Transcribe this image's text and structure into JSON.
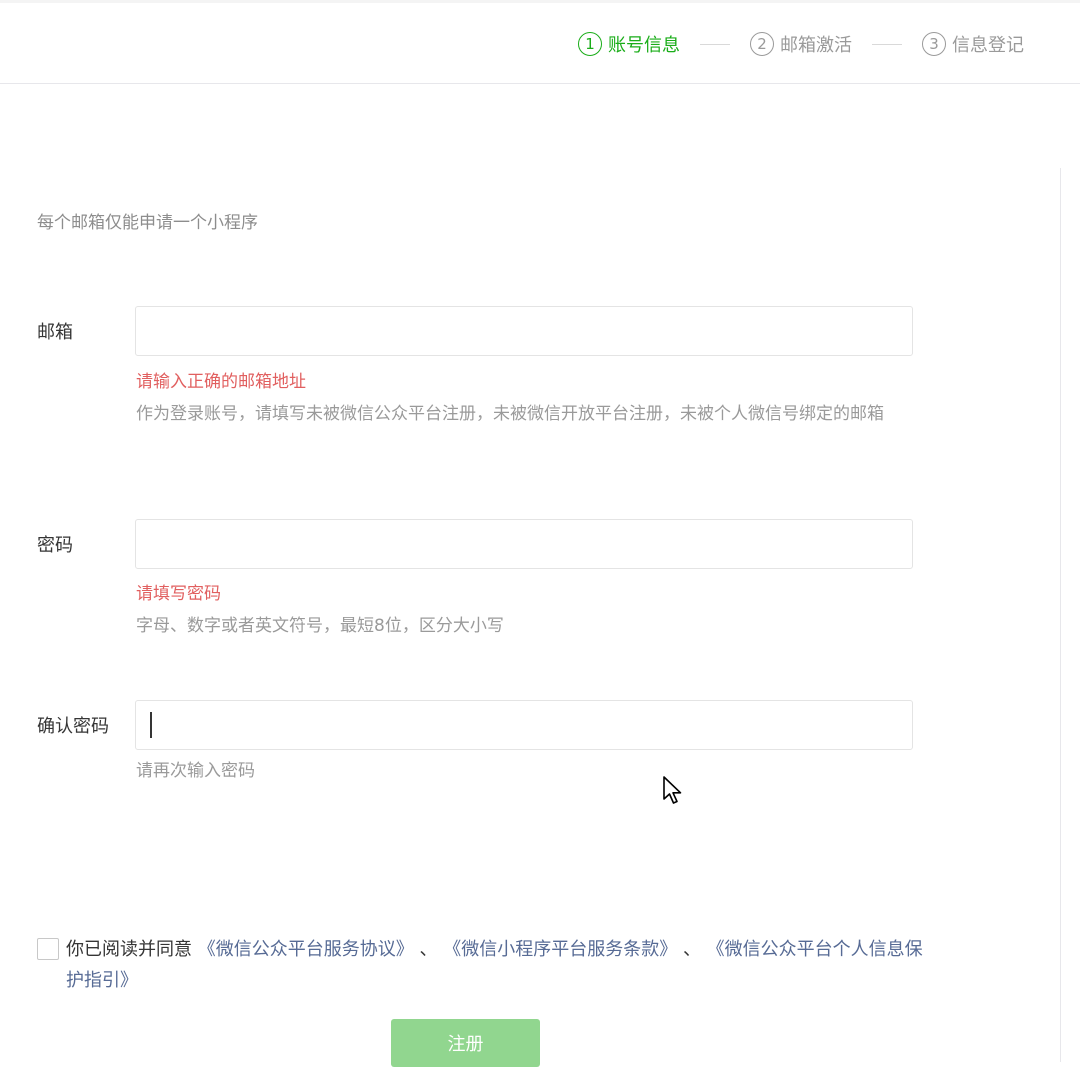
{
  "steps": [
    {
      "num": "1",
      "label": "账号信息",
      "active": true
    },
    {
      "num": "2",
      "label": "邮箱激活",
      "active": false
    },
    {
      "num": "3",
      "label": "信息登记",
      "active": false
    }
  ],
  "tip": "每个邮箱仅能申请一个小程序",
  "email": {
    "label": "邮箱",
    "value": "",
    "error": "请输入正确的邮箱地址",
    "hint": "作为登录账号，请填写未被微信公众平台注册，未被微信开放平台注册，未被个人微信号绑定的邮箱"
  },
  "password": {
    "label": "密码",
    "value": "",
    "error": "请填写密码",
    "hint": "字母、数字或者英文符号，最短8位，区分大小写"
  },
  "confirm": {
    "label": "确认密码",
    "value": "",
    "hint": "请再次输入密码"
  },
  "agreement": {
    "prefix": "你已阅读并同意",
    "link1": "《微信公众平台服务协议》",
    "sep1": "、",
    "link2": "《微信小程序平台服务条款》",
    "sep2": "、",
    "link3": "《微信公众平台个人信息保护指引》",
    "checked": false
  },
  "submit_label": "注册",
  "colors": {
    "accent": "#1aad19",
    "error": "#e15f5f",
    "link": "#576b95",
    "button_disabled": "#91d68f"
  }
}
